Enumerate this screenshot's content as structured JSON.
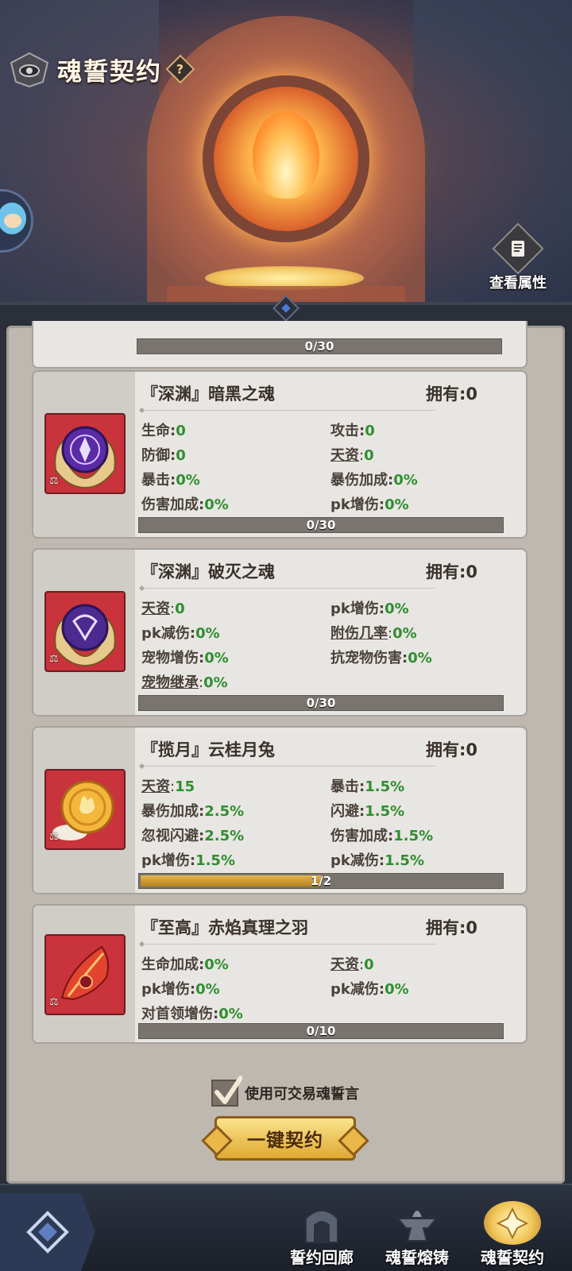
{
  "header": {
    "title": "魂誓契约",
    "help_icon": "?",
    "view_attributes_label": "查看属性"
  },
  "top_partial_card": {
    "progress_text": "0/30",
    "progress": 0
  },
  "cards": [
    {
      "name": "『深渊』暗黑之魂",
      "owned_label": "拥有:",
      "owned": "0",
      "icon": "purple-orb-icon",
      "stats": [
        {
          "k": "生命:",
          "v": "0"
        },
        {
          "k": "攻击:",
          "v": "0"
        },
        {
          "k": "防御:",
          "v": "0"
        },
        {
          "k": "天资",
          "v": "0",
          "underline": true
        },
        {
          "k": "暴击:",
          "v": "0%"
        },
        {
          "k": "暴伤加成:",
          "v": "0%"
        },
        {
          "k": "伤害加成:",
          "v": "0%"
        },
        {
          "k": "pk增伤:",
          "v": "0%"
        }
      ],
      "progress_text": "0/30",
      "progress": 0
    },
    {
      "name": "『深渊』破灭之魂",
      "owned_label": "拥有:",
      "owned": "0",
      "icon": "purple-orb-icon",
      "stats": [
        {
          "k": "天资",
          "v": "0",
          "underline": true
        },
        {
          "k": "pk增伤:",
          "v": "0%"
        },
        {
          "k": "pk减伤:",
          "v": "0%"
        },
        {
          "k": "附伤几率",
          "v": "0%",
          "underline": true
        },
        {
          "k": "宠物增伤:",
          "v": "0%"
        },
        {
          "k": "抗宠物伤害:",
          "v": "0%"
        },
        {
          "k": "宠物继承",
          "v": "0%",
          "underline": true
        }
      ],
      "progress_text": "0/30",
      "progress": 0
    },
    {
      "name": "『揽月』云桂月兔",
      "owned_label": "拥有:",
      "owned": "0",
      "icon": "mooncake-rabbit-icon",
      "stats": [
        {
          "k": "天资",
          "v": "15",
          "underline": true
        },
        {
          "k": "暴击:",
          "v": "1.5%"
        },
        {
          "k": "暴伤加成:",
          "v": "2.5%"
        },
        {
          "k": "闪避:",
          "v": "1.5%"
        },
        {
          "k": "忽视闪避:",
          "v": "2.5%"
        },
        {
          "k": "伤害加成:",
          "v": "1.5%"
        },
        {
          "k": "pk增伤:",
          "v": "1.5%"
        },
        {
          "k": "pk减伤:",
          "v": "1.5%"
        }
      ],
      "progress_text": "1/2",
      "progress": 0.5
    },
    {
      "name": "『至高』赤焰真理之羽",
      "owned_label": "拥有:",
      "owned": "0",
      "icon": "red-feather-icon",
      "stats": [
        {
          "k": "生命加成:",
          "v": "0%"
        },
        {
          "k": "天资",
          "v": "0",
          "underline": true
        },
        {
          "k": "pk增伤:",
          "v": "0%"
        },
        {
          "k": "pk减伤:",
          "v": "0%"
        },
        {
          "k": "对首领增伤:",
          "v": "0%"
        }
      ],
      "progress_text": "0/10",
      "progress": 0
    }
  ],
  "use_tradeable": {
    "label": "使用可交易魂誓言",
    "checked": true
  },
  "contract_button": "一键契约",
  "nav": {
    "items": [
      {
        "label": "誓约回廊",
        "icon": "gate-icon"
      },
      {
        "label": "魂誓熔铸",
        "icon": "anvil-icon"
      },
      {
        "label": "魂誓契约",
        "icon": "contract-emblem-icon",
        "active": true
      }
    ]
  },
  "colors": {
    "stat_value": "#2f8e2f",
    "card_icon_bg": "#c9333b",
    "button": "#e0a931"
  }
}
